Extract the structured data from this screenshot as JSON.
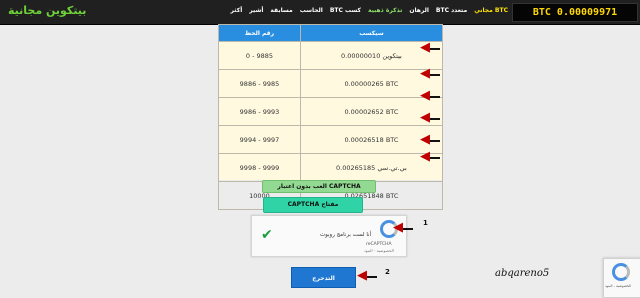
{
  "header": {
    "balance": "BTC 0.00009971",
    "brand": "بيتكوين مجانية",
    "nav": [
      {
        "label": "مجاني BTC",
        "style": "hl"
      },
      {
        "label": "BTC متعدد",
        "style": ""
      },
      {
        "label": "الرهان",
        "style": ""
      },
      {
        "label": "تذكرة ذهبية",
        "style": "gr"
      },
      {
        "label": "BTC كسب",
        "style": ""
      },
      {
        "label": "الحاسب",
        "style": ""
      },
      {
        "label": "مسابقة",
        "style": ""
      },
      {
        "label": "أشير",
        "style": ""
      },
      {
        "label": "أكثر",
        "style": ""
      }
    ]
  },
  "table": {
    "headers": [
      "رقم الحظ",
      "سيكسب"
    ],
    "rows": [
      {
        "range": "0 - 9885",
        "prize": "بيتكوين 0.00000010"
      },
      {
        "range": "9886 - 9985",
        "prize": "0.00000265 BTC"
      },
      {
        "range": "9986 - 9993",
        "prize": "0.00002652 BTC"
      },
      {
        "range": "9994 - 9997",
        "prize": "0.00026518 BTC"
      },
      {
        "range": "9998 - 9999",
        "prize": "بي.تي.سي 0.00265185"
      },
      {
        "range": "10000",
        "prize": "0.02651848 BTC"
      }
    ]
  },
  "buttons": {
    "play_without_captcha": "العب بدون اعتبار CAPTCHA",
    "solve_captcha": "CAPTCHA مفتاح",
    "roll": "التدحرج"
  },
  "captcha": {
    "label": "أنا لست برنامج روبوت",
    "brand": "reCAPTCHA",
    "terms": "الخصوصية - البنود"
  },
  "annotations": {
    "step1": "1",
    "step2": "2"
  },
  "watermark": "abqareno5",
  "badge_terms": "الخصوصية - البنود",
  "colors": {
    "topbar": "#202020",
    "balance_text": "#ffd800",
    "brand": "#6fd23a",
    "table_header": "#2a8ee0",
    "roll_button": "#1f77d2",
    "arrow": "#c00000"
  }
}
